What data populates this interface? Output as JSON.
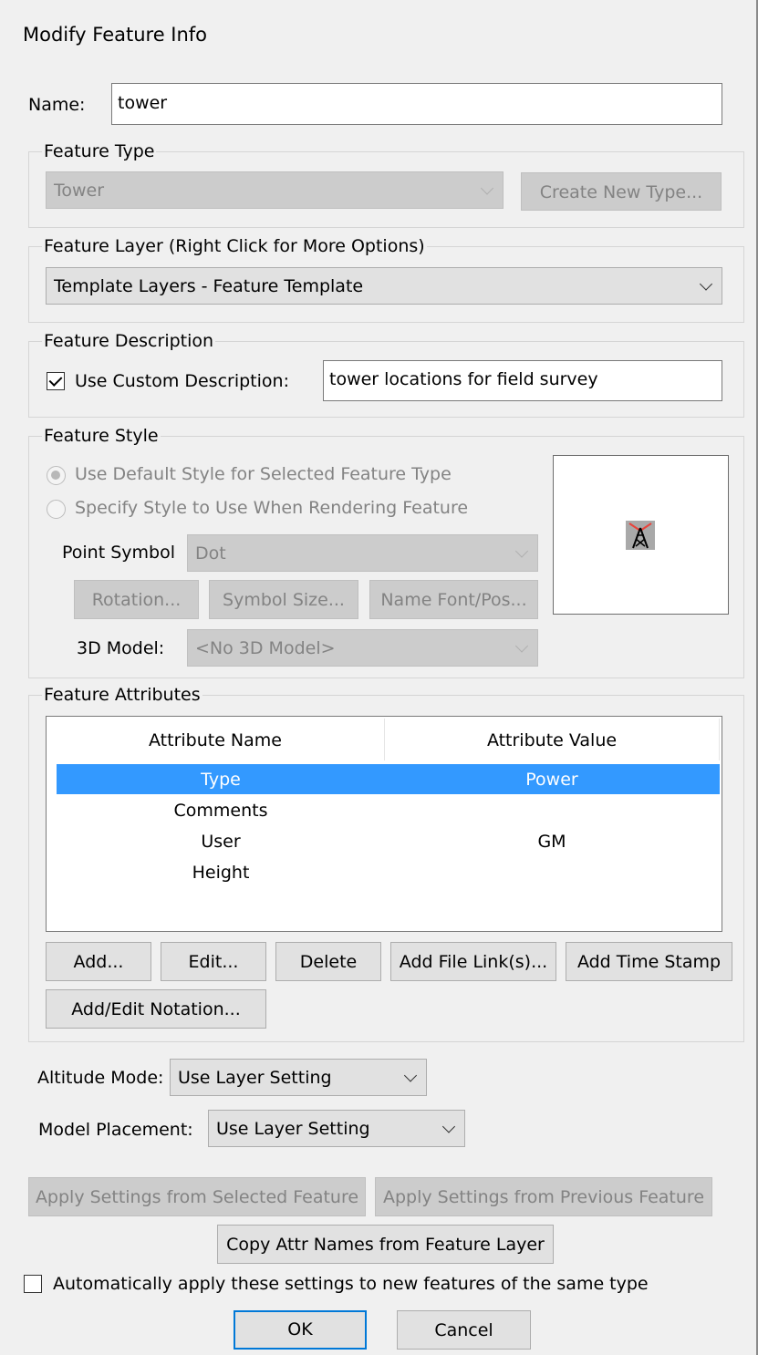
{
  "dialog": {
    "title": "Modify Feature Info"
  },
  "name": {
    "label": "Name:",
    "value": "tower"
  },
  "feature_type": {
    "group_label": "Feature Type",
    "selected": "Tower",
    "create_button": "Create New Type..."
  },
  "feature_layer": {
    "group_label": "Feature Layer (Right Click for More Options)",
    "selected": "Template Layers - Feature Template"
  },
  "feature_description": {
    "group_label": "Feature Description",
    "checkbox_label": "Use Custom Description:",
    "checked": true,
    "value": "tower locations for field survey"
  },
  "feature_style": {
    "group_label": "Feature Style",
    "radio_default": "Use Default Style for Selected Feature Type",
    "radio_specify": "Specify Style to Use When Rendering Feature",
    "point_symbol_label": "Point Symbol",
    "point_symbol_value": "Dot",
    "rotation_button": "Rotation...",
    "symbol_size_button": "Symbol Size...",
    "name_font_button": "Name Font/Pos...",
    "model_label": "3D Model:",
    "model_value": "<No 3D Model>",
    "preview_icon": "tower-symbol-icon"
  },
  "feature_attributes": {
    "group_label": "Feature Attributes",
    "columns": [
      "Attribute Name",
      "Attribute Value"
    ],
    "rows": [
      {
        "name": "Type",
        "value": "Power",
        "selected": true
      },
      {
        "name": "Comments",
        "value": ""
      },
      {
        "name": "User",
        "value": "GM"
      },
      {
        "name": "Height",
        "value": ""
      }
    ],
    "buttons": {
      "add": "Add...",
      "edit": "Edit...",
      "delete": "Delete",
      "add_file_link": "Add File Link(s)...",
      "add_time_stamp": "Add Time Stamp",
      "add_edit_notation": "Add/Edit Notation..."
    }
  },
  "altitude_mode": {
    "label": "Altitude Mode:",
    "value": "Use Layer Setting"
  },
  "model_placement": {
    "label": "Model Placement:",
    "value": "Use Layer Setting"
  },
  "apply_selected_button": "Apply Settings from Selected Feature",
  "apply_previous_button": "Apply Settings from Previous Feature",
  "copy_attr_button": "Copy Attr Names from Feature Layer",
  "auto_apply": {
    "label": "Automatically apply these settings to new features of the same type",
    "checked": false
  },
  "ok_button": "OK",
  "cancel_button": "Cancel",
  "colors": {
    "selection": "#3399ff",
    "default_button_border": "#0078d7",
    "window_bg": "#f0f0f0"
  }
}
